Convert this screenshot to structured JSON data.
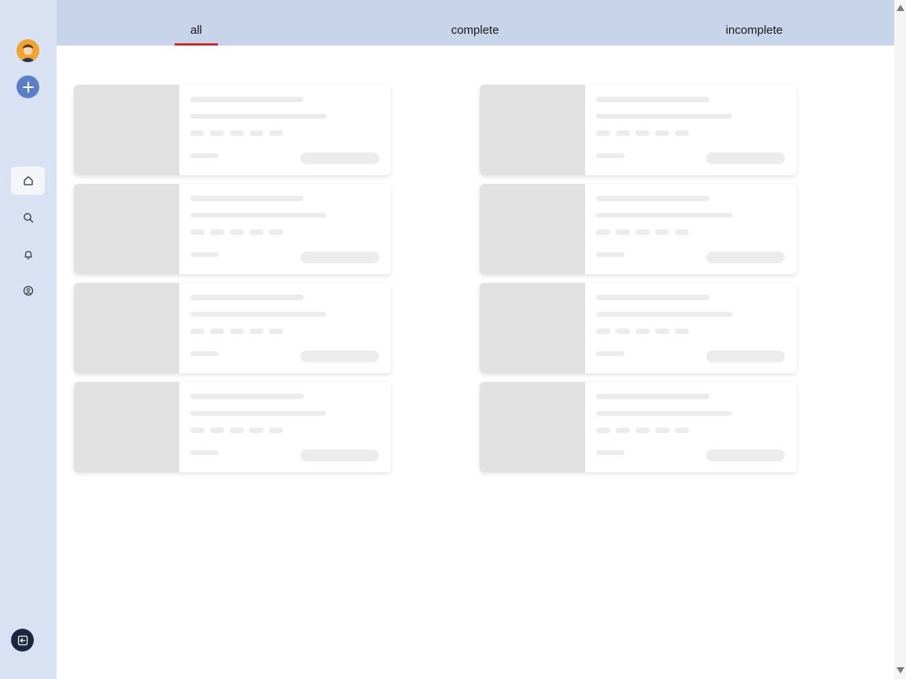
{
  "sidebar": {
    "avatar_icon": "user-avatar",
    "add_icon": "plus-icon",
    "nav": [
      {
        "name": "home",
        "icon": "home-icon",
        "active": true
      },
      {
        "name": "search",
        "icon": "search-icon",
        "active": false
      },
      {
        "name": "notifications",
        "icon": "bell-icon",
        "active": false
      },
      {
        "name": "profile",
        "icon": "user-circle-icon",
        "active": false
      }
    ],
    "logout_icon": "logout-icon"
  },
  "tabs": [
    {
      "label": "all",
      "active": true
    },
    {
      "label": "complete",
      "active": false
    },
    {
      "label": "incomplete",
      "active": false
    }
  ],
  "colors": {
    "sidebar_bg": "#d9e2f2",
    "tabbar_bg": "#c8d4ea",
    "active_tab_underline": "#c9302c",
    "add_button": "#5b7fc7",
    "logout_button": "#1b2640",
    "skeleton": "#ececec",
    "thumb": "#e1e1e1"
  },
  "cards": {
    "state": "loading-skeleton",
    "count": 8
  }
}
